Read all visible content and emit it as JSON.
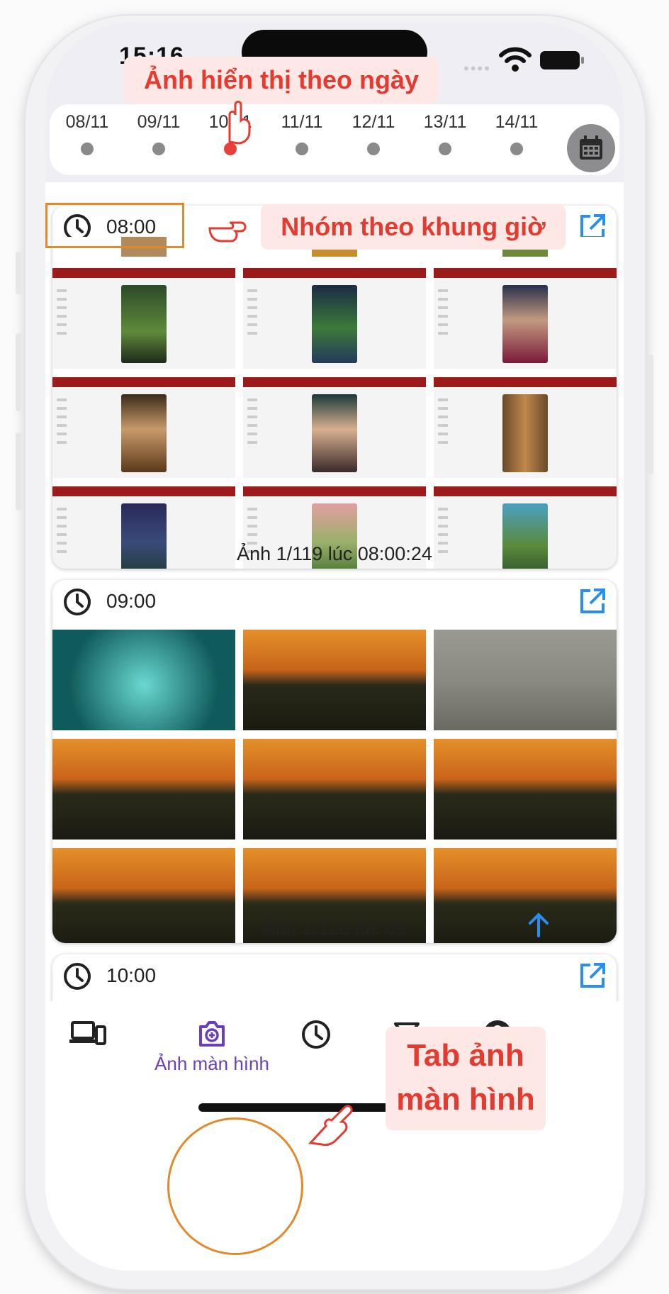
{
  "status_bar": {
    "time": "15:16"
  },
  "annotations": {
    "dates_caption": "Ảnh hiển thị theo ngày",
    "group_caption": "Nhóm theo khung giờ",
    "tab_caption_line1": "Tab ảnh",
    "tab_caption_line2": "màn hình"
  },
  "date_strip": {
    "dates": [
      "08/11",
      "09/11",
      "10/11",
      "11/11",
      "12/11",
      "13/11",
      "14/11"
    ],
    "selected_index": 2
  },
  "groups": [
    {
      "time": "08:00",
      "caption": "Ảnh 1/119 lúc 08:00:24"
    },
    {
      "time": "09:00",
      "caption": "Ảnh 1/120 lúc 09"
    },
    {
      "time": "10:00"
    }
  ],
  "bottom_nav": {
    "items": [
      {
        "icon": "devices-icon",
        "label": ""
      },
      {
        "icon": "camera-icon",
        "label": "Ảnh màn hình"
      },
      {
        "icon": "history-clock-icon",
        "label": ""
      },
      {
        "icon": "filter-icon",
        "label": ""
      },
      {
        "icon": "account-icon",
        "label": ""
      }
    ],
    "active_index": 1
  },
  "colors": {
    "accent": "#6a3fbf",
    "annotation_red": "#e53a2f",
    "annotation_orange": "#e08a2c",
    "open_link_blue": "#2a8ef0",
    "active_dot": "#e8403a"
  }
}
